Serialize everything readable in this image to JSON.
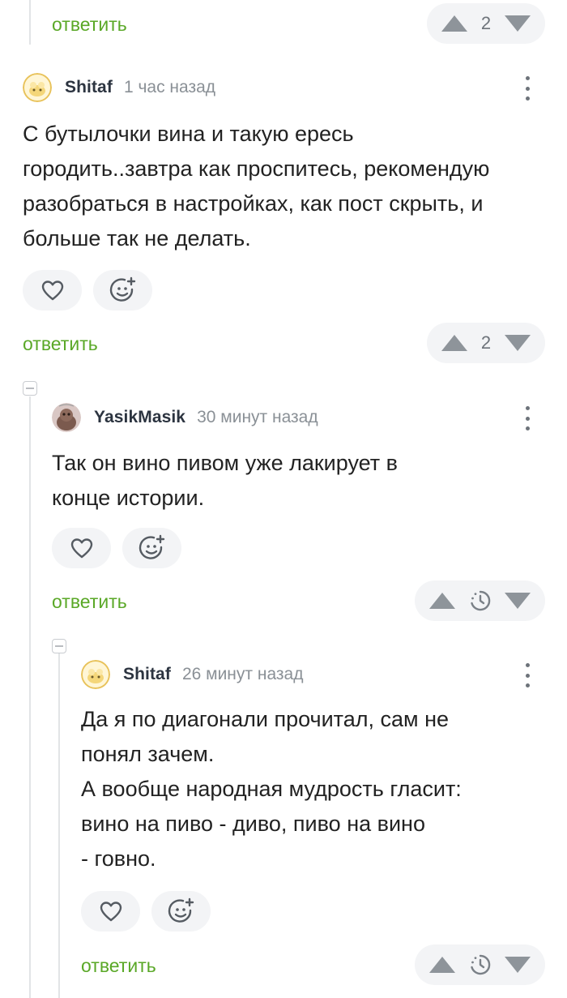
{
  "top_item": {
    "reply_label": "ответить",
    "votes": "2"
  },
  "comments": [
    {
      "username": "Shitaf",
      "time": "1 час назад",
      "text": "С бутылочки вина и такую ересь\nгородить..завтра как проспитесь, рекомендую\nразобраться в настройках, как пост скрыть, и\nбольше так не делать.",
      "reply_label": "ответить",
      "votes": "2"
    },
    {
      "username": "YasikMasik",
      "time": "30 минут назад",
      "text": "Так он вино пивом уже лакирует в\nконце истории.",
      "reply_label": "ответить",
      "votes_pending": true
    },
    {
      "username": "Shitaf",
      "time": "26 минут назад",
      "text": "Да я по диагонали прочитал, сам не\nпонял зачем.\nА вообще народная мудрость гласит:\nвино на пиво - диво, пиво на вино\n- говно.",
      "reply_label": "ответить",
      "votes_pending": true
    }
  ],
  "colors": {
    "reply_green": "#5aa827",
    "pill_background": "#f3f4f6",
    "icon_gray": "#8e949a",
    "thread_line": "#e2e4e6"
  },
  "icons": {
    "like": "heart-icon",
    "reaction": "add-emoji-icon",
    "menu": "more-vertical-icon",
    "upvote": "arrow-up-icon",
    "downvote": "arrow-down-icon",
    "pending": "clock-icon"
  }
}
